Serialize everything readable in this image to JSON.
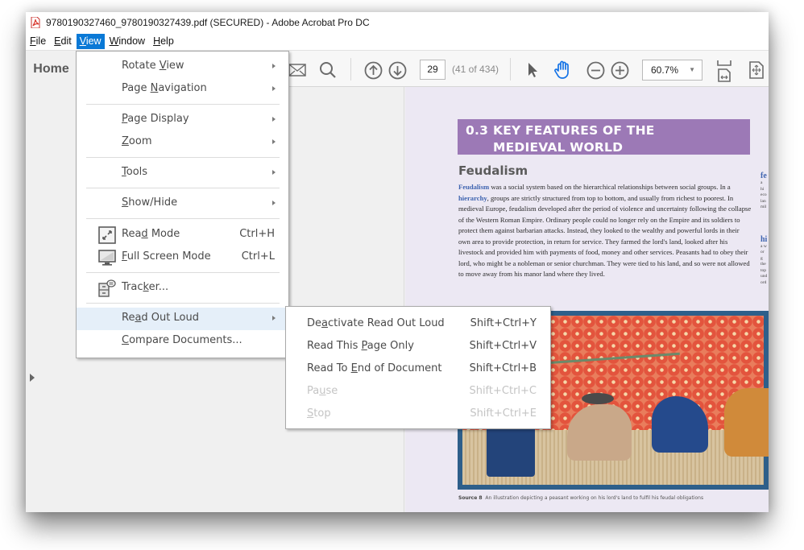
{
  "window": {
    "title": "9780190327460_9780190327439.pdf (SECURED) - Adobe Acrobat Pro DC"
  },
  "menubar": [
    {
      "label_pre": "",
      "accel": "F",
      "label_post": "ile"
    },
    {
      "label_pre": "",
      "accel": "E",
      "label_post": "dit"
    },
    {
      "label_pre": "",
      "accel": "V",
      "label_post": "iew",
      "active": true
    },
    {
      "label_pre": "",
      "accel": "W",
      "label_post": "indow"
    },
    {
      "label_pre": "",
      "accel": "H",
      "label_post": "elp"
    }
  ],
  "toolbar": {
    "home_tab": "Home",
    "page_number": "29",
    "page_count": "(41 of 434)",
    "zoom_level": "60.7%",
    "icons": [
      "email-icon",
      "search-icon",
      "previous-page-icon",
      "next-page-icon",
      "select-pointer-icon",
      "hand-tool-icon",
      "zoom-out-icon",
      "zoom-in-icon",
      "fit-width-icon",
      "fit-page-icon"
    ]
  },
  "view_menu": {
    "items": [
      {
        "pre": "Rotate ",
        "accel": "V",
        "post": "iew",
        "submenu": true
      },
      {
        "pre": "Page ",
        "accel": "N",
        "post": "avigation",
        "submenu": true
      },
      {
        "pre": "",
        "accel": "P",
        "post": "age Display",
        "submenu": true
      },
      {
        "pre": "",
        "accel": "Z",
        "post": "oom",
        "submenu": true
      },
      {
        "pre": "",
        "accel": "T",
        "post": "ools",
        "submenu": true
      },
      {
        "pre": "",
        "accel": "S",
        "post": "how/Hide",
        "submenu": true
      },
      {
        "pre": "Rea",
        "accel": "d",
        "post": " Mode",
        "shortcut": "Ctrl+H",
        "icon": "read-mode-icon"
      },
      {
        "pre": "",
        "accel": "F",
        "post": "ull Screen Mode",
        "shortcut": "Ctrl+L",
        "icon": "full-screen-icon"
      },
      {
        "pre": "Trac",
        "accel": "k",
        "post": "er...",
        "icon": "tracker-icon"
      },
      {
        "pre": "Re",
        "accel": "a",
        "post": "d Out Loud",
        "submenu": true,
        "highlighted": true
      },
      {
        "pre": "",
        "accel": "C",
        "post": "ompare Documents..."
      }
    ]
  },
  "read_out_loud_submenu": {
    "items": [
      {
        "pre": "De",
        "accel": "a",
        "post": "ctivate Read Out Loud",
        "shortcut": "Shift+Ctrl+Y",
        "enabled": true
      },
      {
        "pre": "Read This ",
        "accel": "P",
        "post": "age Only",
        "shortcut": "Shift+Ctrl+V",
        "enabled": true
      },
      {
        "pre": "Read To ",
        "accel": "E",
        "post": "nd of Document",
        "shortcut": "Shift+Ctrl+B",
        "enabled": true
      },
      {
        "pre": "Pa",
        "accel": "u",
        "post": "se",
        "shortcut": "Shift+Ctrl+C",
        "enabled": false
      },
      {
        "pre": "",
        "accel": "S",
        "post": "top",
        "shortcut": "Shift+Ctrl+E",
        "enabled": false
      }
    ]
  },
  "document": {
    "chapter_number": "0.3",
    "chapter_title_line1": "KEY FEATURES OF THE",
    "chapter_title_line2": "MEDIEVAL WORLD",
    "section_heading": "Feudalism",
    "para_kw1": "Feudalism",
    "para_part1": " was a social system based on the hierarchical relationships between social groups. In a ",
    "para_kw2": "hierarchy",
    "para_part2": ", groups are strictly structured from top to bottom, and usually from richest to poorest. In medieval Europe, feudalism developed after the period of violence and uncertainty following the collapse of the Western Roman Empire. Ordinary people could no longer rely on the Empire and its soldiers to protect them against barbarian attacks. Instead, they looked to the wealthy and powerful lords in their own area to provide protection, in return for service. They farmed the lord's land, looked after his livestock and provided him with payments of food, money and other services. Peasants had to obey their lord, who might be a nobleman or senior churchman. They were tied to his land, and so were not allowed to move away from his manor land where they lived.",
    "margin_note1_term": "fe",
    "margin_note1_text": "a hi eco lan mil",
    "margin_note2_term": "hi",
    "margin_note2_text": "a w or g the top und ord",
    "caption_label": "Source 8",
    "caption_text": "An illustration depicting a peasant working on his lord's land to fulfil his feudal obligations"
  },
  "colors": {
    "menu_active": "#0a79d6",
    "menu_highlight": "#e5eff9",
    "chapter_banner": "#9c79b6",
    "keyword_blue": "#3f64b0",
    "page_background": "#ece8f3",
    "hand_tool_active": "#1473e6"
  }
}
